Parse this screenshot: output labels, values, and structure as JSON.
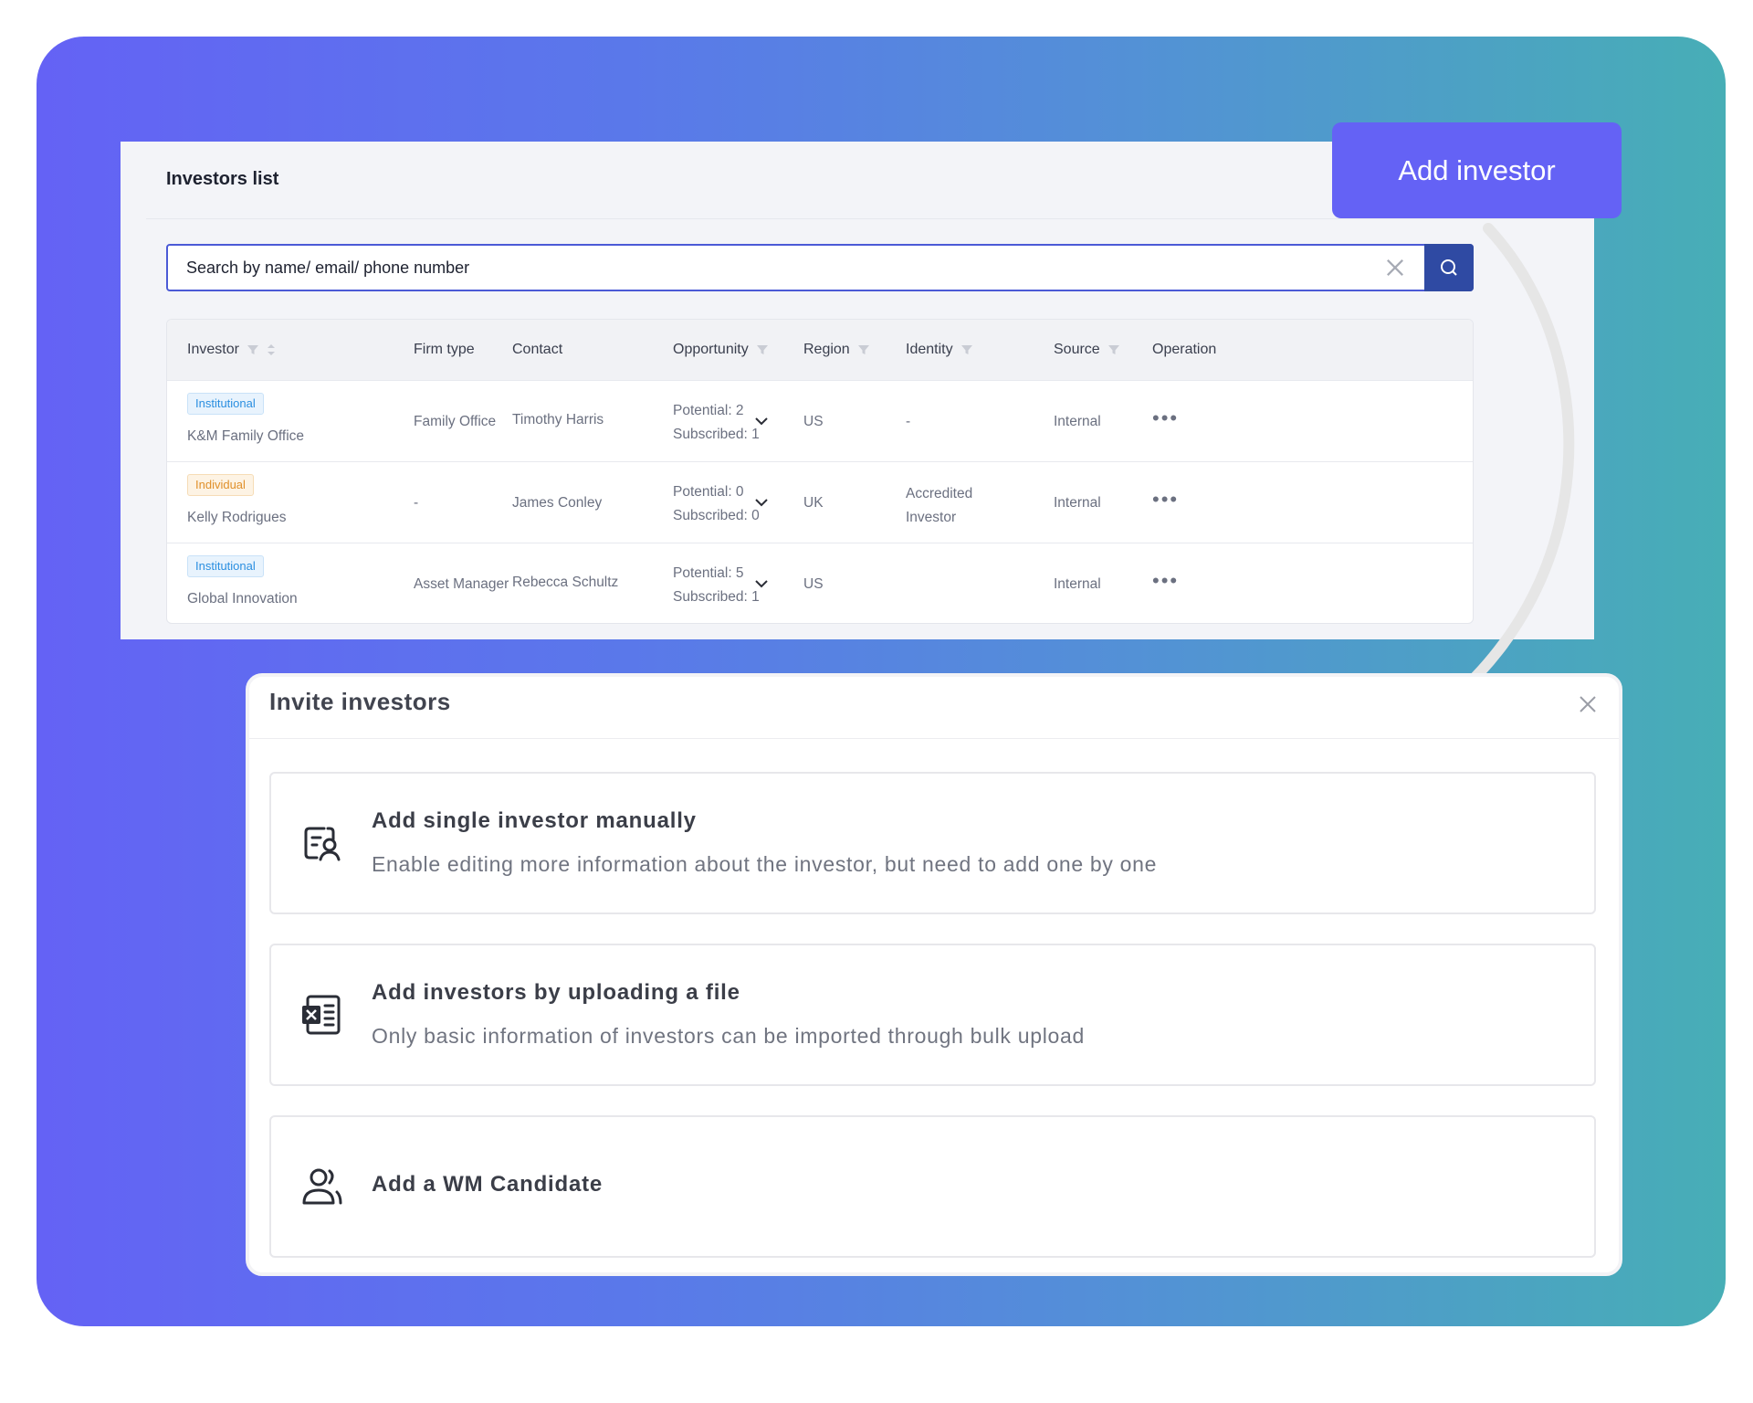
{
  "list": {
    "title": "Investors list",
    "search_placeholder": "Search by name/ email/ phone number",
    "columns": [
      "Investor",
      "Firm type",
      "Contact",
      "Opportunity",
      "Region",
      "Identity",
      "Source",
      "Operation"
    ],
    "rows": [
      {
        "tag": "Institutional",
        "name": "K&M Family Office",
        "firm_type": "Family Office",
        "contact": "Timothy Harris",
        "potential": "Potential: 2",
        "subscribed": "Subscribed: 1",
        "region": "US",
        "identity": "-",
        "source": "Internal",
        "op": "•••"
      },
      {
        "tag": "Individual",
        "name": "Kelly Rodrigues",
        "firm_type": "-",
        "contact": "James Conley",
        "potential": "Potential: 0",
        "subscribed": "Subscribed: 0",
        "region": "UK",
        "identity_line1": "Accredited",
        "identity_line2": "Investor",
        "source": "Internal",
        "op": "•••"
      },
      {
        "tag": "Institutional",
        "name": "Global Innovation",
        "firm_type": "Asset Manager",
        "contact": "Rebecca Schultz",
        "potential": "Potential: 5",
        "subscribed": "Subscribed: 1",
        "region": "US",
        "identity": "",
        "source": "Internal",
        "op": "•••"
      }
    ]
  },
  "add_button": "Add investor",
  "modal": {
    "title": "Invite investors",
    "options": [
      {
        "icon": "id-card-icon",
        "title": "Add single investor manually",
        "desc": "Enable editing more information about the investor, but need to add one by one"
      },
      {
        "icon": "excel-file-icon",
        "title": "Add investors by uploading a file",
        "desc": "Only basic information of investors can be imported through bulk upload"
      },
      {
        "icon": "users-icon",
        "title": "Add a WM Candidate",
        "desc": ""
      }
    ]
  },
  "colors": {
    "accent": "#6462f5",
    "search_button": "#2f4aa3",
    "tag_institutional": "#2b8fe0",
    "tag_individual": "#e0902b"
  }
}
